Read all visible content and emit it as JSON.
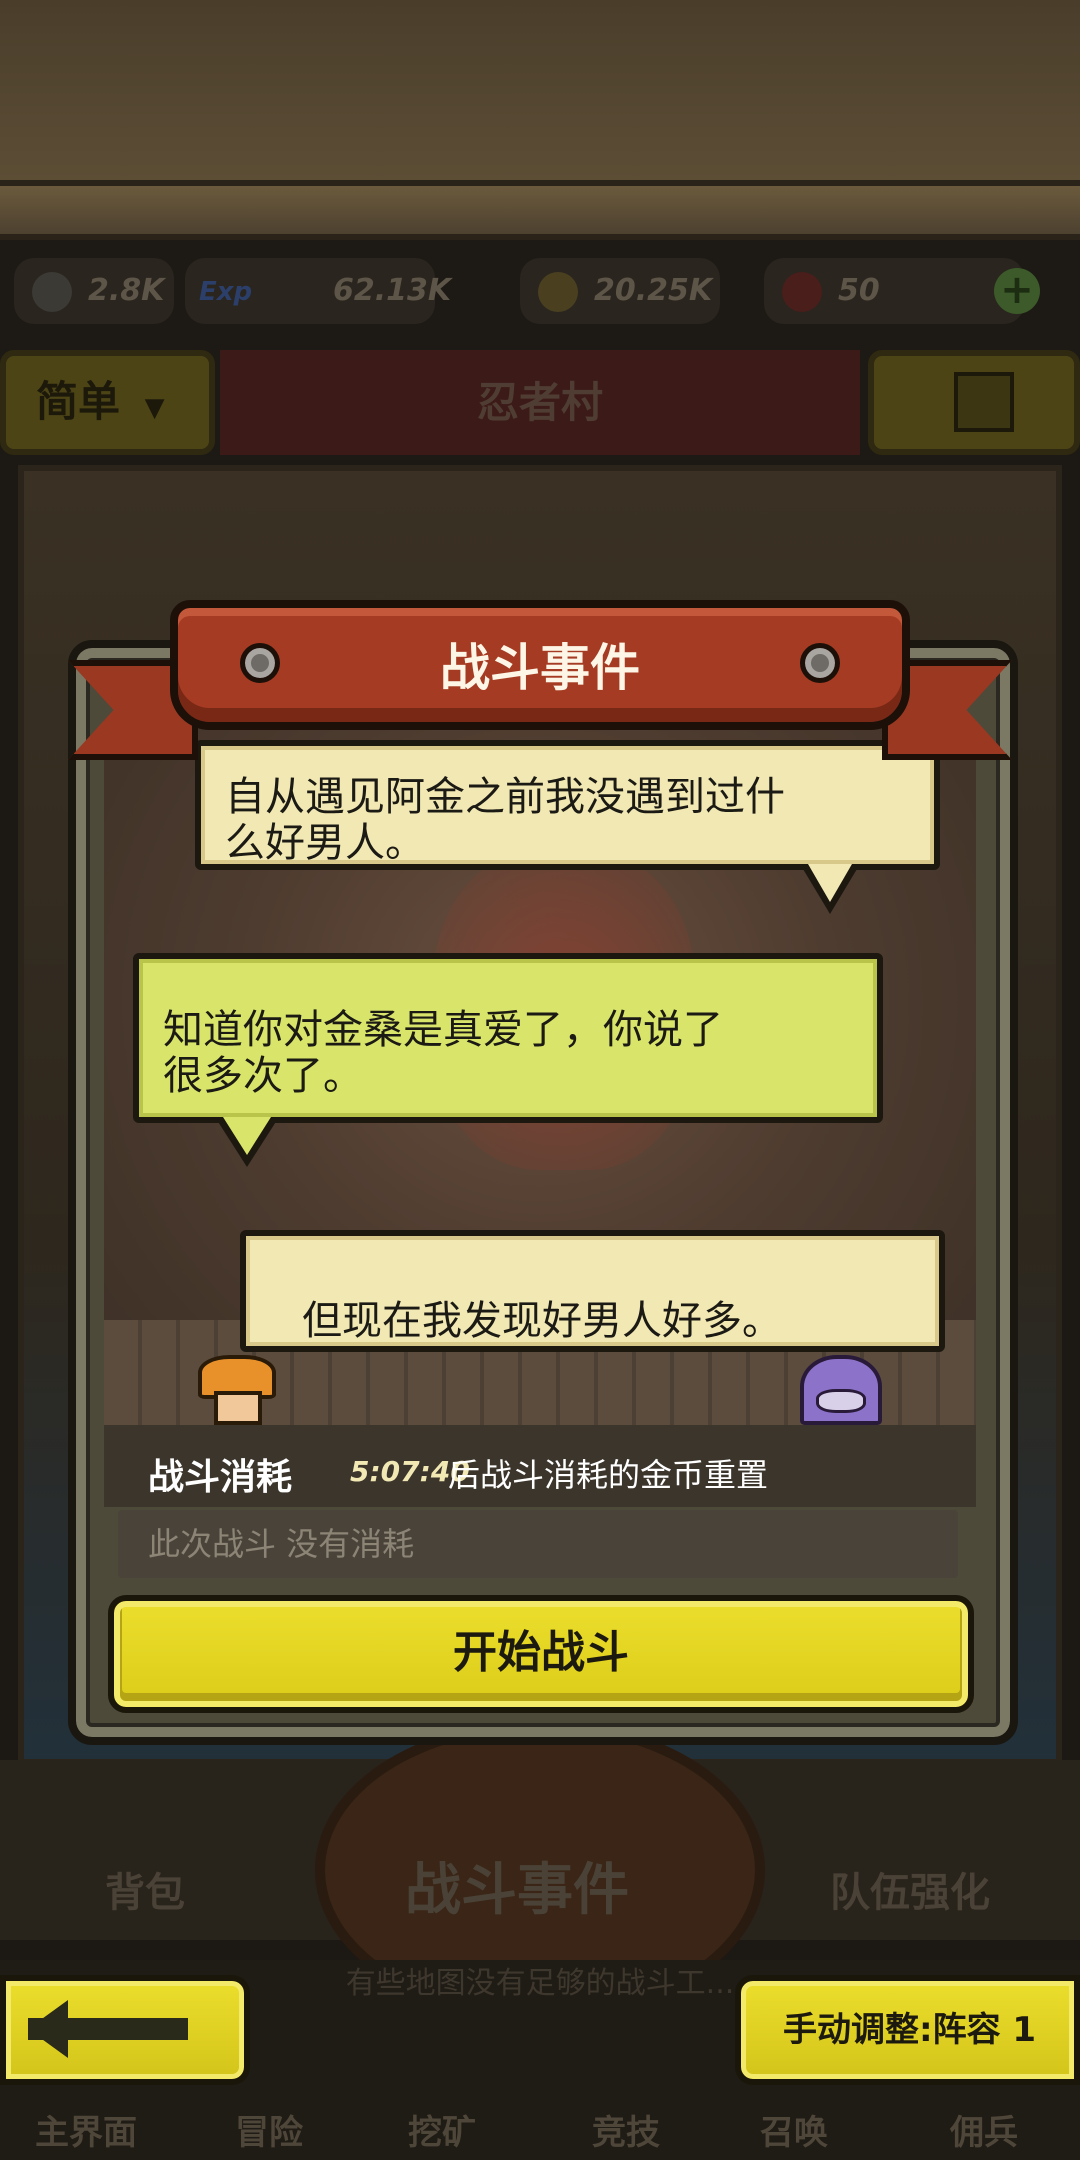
{
  "resources": {
    "attack": "2.8K",
    "exp_icon_text": "Exp",
    "exp": "62.13K",
    "gold": "20.25K",
    "meat": "50"
  },
  "header": {
    "difficulty": "简单",
    "region": "忍者村"
  },
  "modal": {
    "title": "战斗事件",
    "dialogue": [
      {
        "text_line1": "自从遇见阿金之前我没遇到过什",
        "text_line2": "么好男人。"
      },
      {
        "text_line1": "知道你对金桑是真爱了，你说了",
        "text_line2": "很多次了。"
      },
      {
        "text_line1": "但现在我发现好男人好多。"
      }
    ],
    "cost_label": "战斗消耗",
    "cost_timer": "5:07:40",
    "cost_reset_text": "后战斗消耗的金币重置",
    "cost_value": "此次战斗 没有消耗",
    "start_button": "开始战斗"
  },
  "bottom_panel": {
    "bag": "背包",
    "battle_event": "战斗事件",
    "team_upgrade": "队伍强化",
    "hint": "有些地图没有足够的战斗工..."
  },
  "nav": {
    "main": "主界面",
    "adventure": "冒险",
    "mine": "挖矿",
    "arena": "竞技",
    "summon": "召唤",
    "mercenary": "佣兵"
  },
  "buttons": {
    "formation": "手动调整:阵容 1"
  },
  "colors": {
    "ribbon": "#a63b23",
    "start_button": "#ecde2c",
    "bubble_cream": "#f1e8b4",
    "bubble_green": "#d9e46a"
  }
}
